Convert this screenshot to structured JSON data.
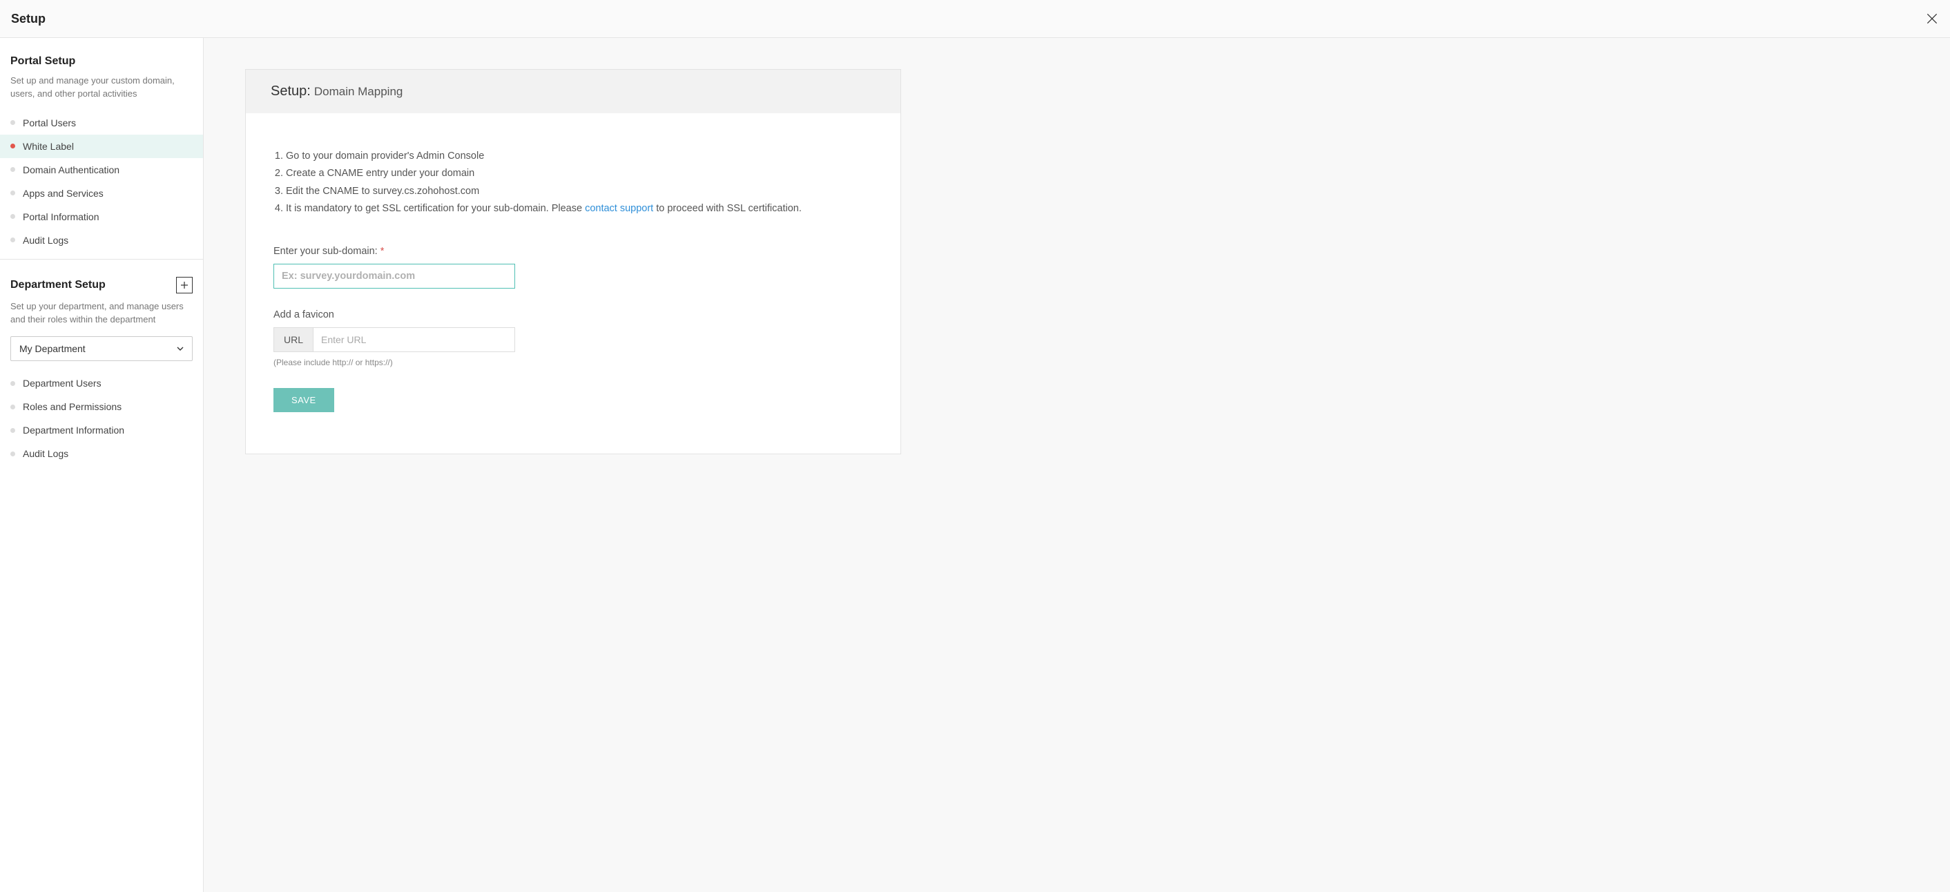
{
  "header": {
    "title": "Setup"
  },
  "sidebar": {
    "portal": {
      "title": "Portal Setup",
      "desc": "Set up and manage your custom domain, users, and other portal activities",
      "items": [
        {
          "label": "Portal Users"
        },
        {
          "label": "White Label"
        },
        {
          "label": "Domain Authentication"
        },
        {
          "label": "Apps and Services"
        },
        {
          "label": "Portal Information"
        },
        {
          "label": "Audit Logs"
        }
      ]
    },
    "department": {
      "title": "Department Setup",
      "desc": "Set up your department, and manage users and their roles within the department",
      "select_value": "My Department",
      "items": [
        {
          "label": "Department Users"
        },
        {
          "label": "Roles and Permissions"
        },
        {
          "label": "Department Information"
        },
        {
          "label": "Audit Logs"
        }
      ]
    }
  },
  "panel": {
    "prefix": "Setup:",
    "title": "Domain Mapping",
    "steps": {
      "s1": "Go to your domain provider's Admin Console",
      "s2": "Create a CNAME entry under your domain",
      "s3": "Edit the CNAME to survey.cs.zohohost.com",
      "s4_a": "It is mandatory to get SSL certification for your sub-domain. Please ",
      "s4_link": "contact support",
      "s4_b": " to proceed with SSL certification."
    },
    "subdomain": {
      "label": "Enter your sub-domain:",
      "placeholder": "Ex: survey.yourdomain.com"
    },
    "favicon": {
      "label": "Add a favicon",
      "url_prefix": "URL",
      "placeholder": "Enter URL",
      "hint": "(Please include http:// or https://)"
    },
    "save_label": "SAVE"
  }
}
